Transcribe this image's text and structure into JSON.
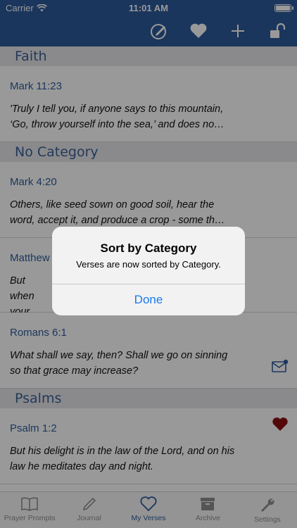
{
  "status_bar": {
    "carrier": "Carrier",
    "time": "11:01 AM"
  },
  "nav": {
    "icons": [
      "edit-circle-icon",
      "heart-icon",
      "plus-icon",
      "unlock-icon"
    ]
  },
  "sections": [
    {
      "header": "Faith",
      "rows": [
        {
          "ref": "Mark 11:23",
          "text": "'Truly I tell you, if anyone says to this mountain, ‘Go, throw yourself into the sea,’ and does no…"
        }
      ]
    },
    {
      "header": "No Category",
      "rows": [
        {
          "ref": "Mark 4:20",
          "text": "Others, like seed sown on good soil, hear the word, accept it, and produce a crop - some th…"
        },
        {
          "ref": "Matthew",
          "text": "But when your face,"
        },
        {
          "ref": "Romans 6:1",
          "text": "What shall we say, then? Shall we go on sinning so that grace may increase?",
          "icon": "mail-badge-icon"
        }
      ]
    },
    {
      "header": "Psalms",
      "rows": [
        {
          "ref": "Psalm 1:2",
          "text": "But his delight is in the law of the Lord, and on his law he meditates day and night.",
          "icon": "heart-filled-icon",
          "icon_color": "#8b0f12"
        }
      ]
    }
  ],
  "alert": {
    "title": "Sort by Category",
    "message": "Verses are now sorted by Category.",
    "button": "Done"
  },
  "tabbar": {
    "tabs": [
      {
        "label": "Prayer Prompts",
        "icon": "book-icon",
        "active": false
      },
      {
        "label": "Journal",
        "icon": "pen-icon",
        "active": false
      },
      {
        "label": "My Verses",
        "icon": "heart-outline-icon",
        "active": true
      },
      {
        "label": "Archive",
        "icon": "archive-box-icon",
        "active": false
      },
      {
        "label": "Settings",
        "icon": "wrench-icon",
        "active": false
      }
    ]
  },
  "colors": {
    "nav_bg": "#2d5a9a",
    "accent": "#2f5d9c",
    "alert_button": "#1a7af0"
  }
}
